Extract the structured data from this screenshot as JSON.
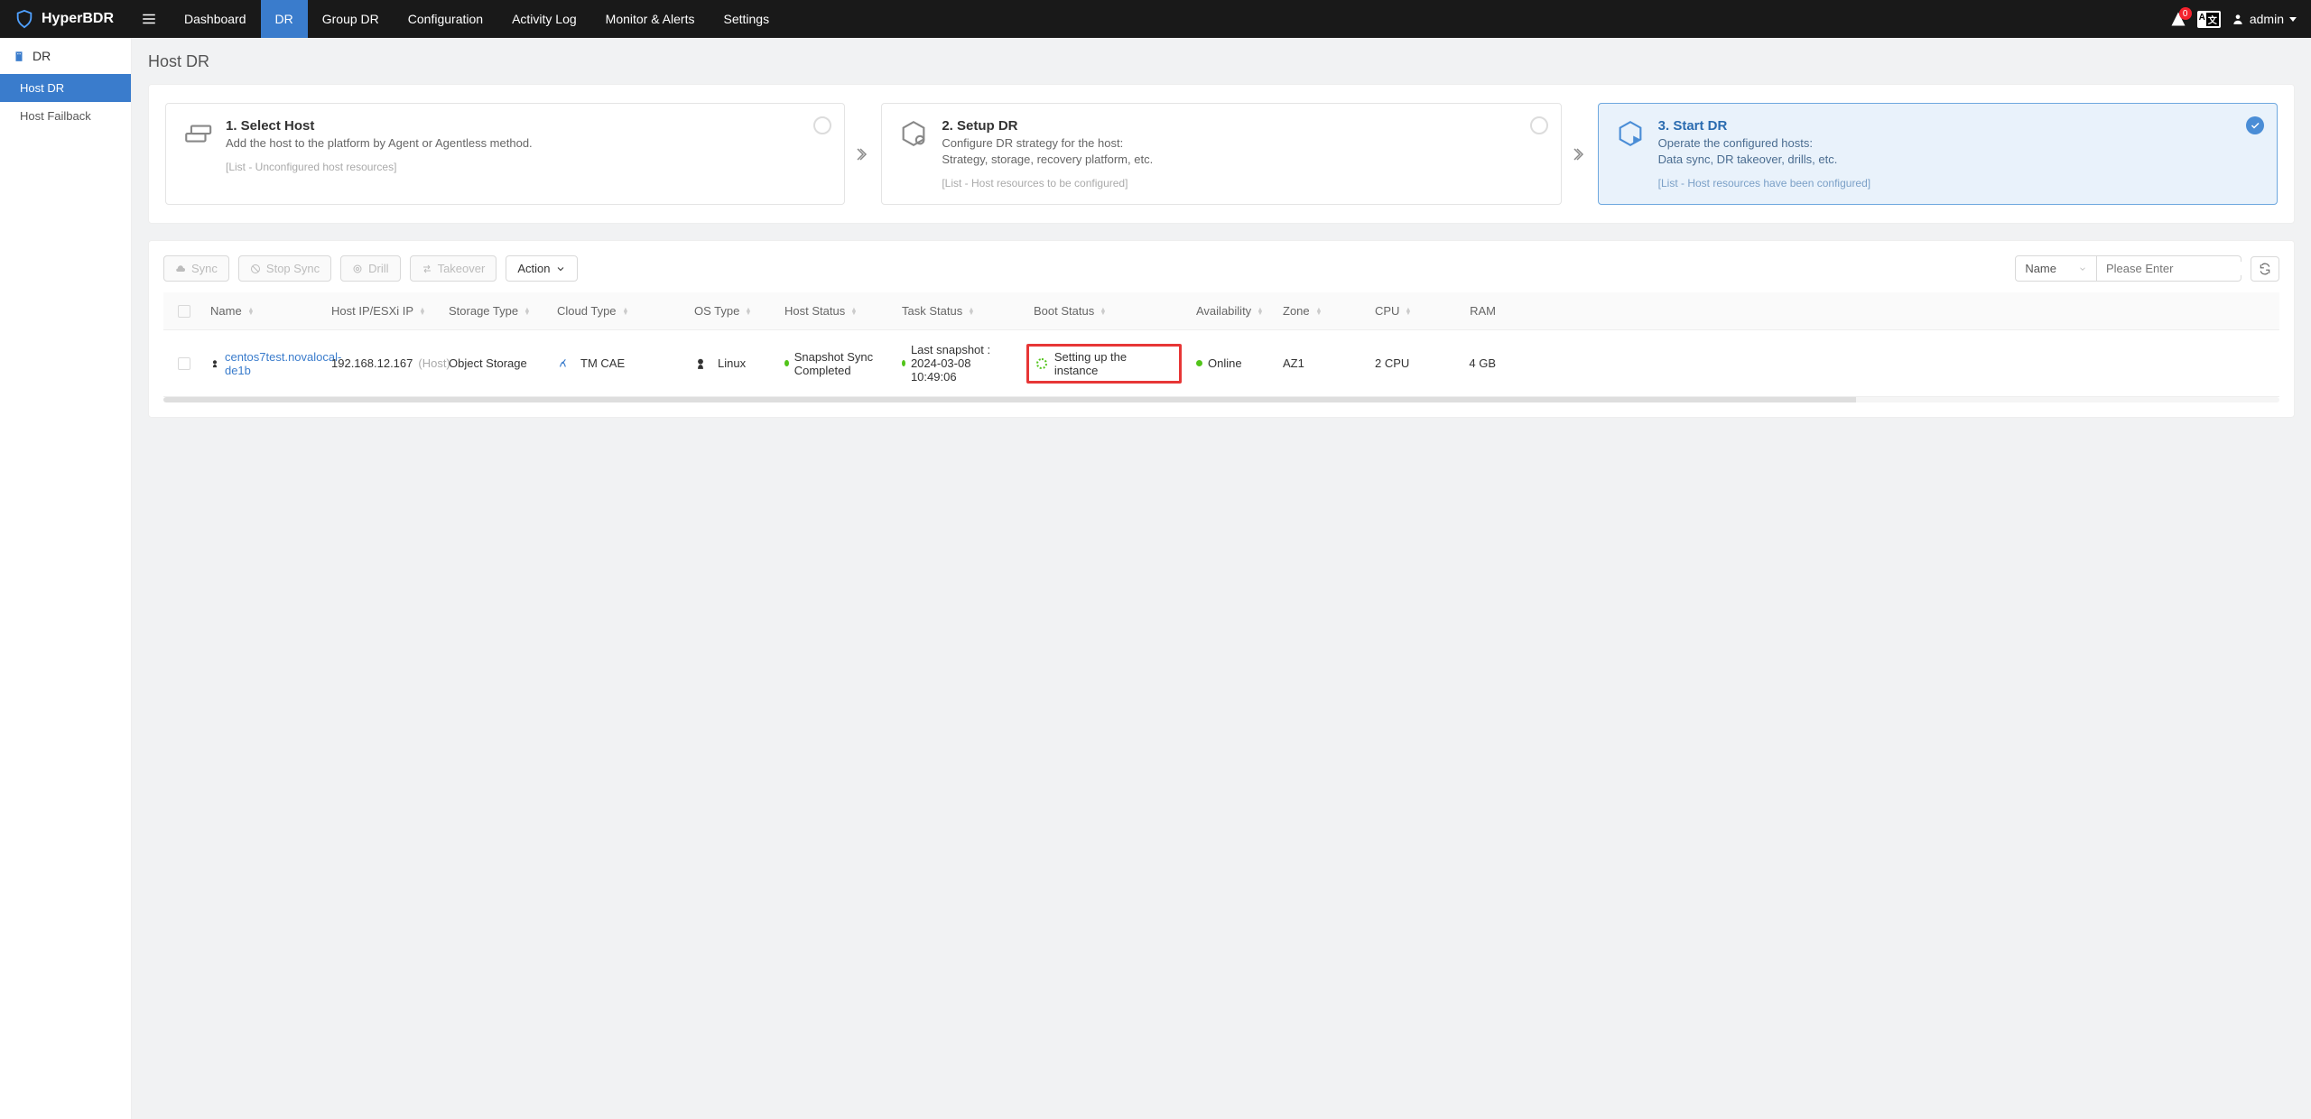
{
  "brand": "HyperBDR",
  "nav": [
    "Dashboard",
    "DR",
    "Group DR",
    "Configuration",
    "Activity Log",
    "Monitor & Alerts",
    "Settings"
  ],
  "nav_active": 1,
  "alerts_count": "0",
  "admin_label": "admin",
  "sidebar": {
    "title": "DR",
    "items": [
      "Host DR",
      "Host Failback"
    ],
    "active": 0
  },
  "page_title": "Host DR",
  "steps": [
    {
      "title": "1. Select Host",
      "desc": "Add the host to the platform by Agent or Agentless method.",
      "sub": "[List - Unconfigured host resources]",
      "state": "circle"
    },
    {
      "title": "2. Setup DR",
      "desc": "Configure DR strategy for the host:\nStrategy, storage, recovery platform, etc.",
      "sub": "[List - Host resources to be configured]",
      "state": "circle"
    },
    {
      "title": "3. Start DR",
      "desc": "Operate the configured hosts:\nData sync, DR takeover, drills, etc.",
      "sub": "[List - Host resources have been configured]",
      "state": "done"
    }
  ],
  "toolbar": {
    "sync": "Sync",
    "stop": "Stop Sync",
    "drill": "Drill",
    "takeover": "Takeover",
    "action": "Action",
    "filter_field": "Name",
    "search_placeholder": "Please Enter"
  },
  "columns": [
    "Name",
    "Host IP/ESXi IP",
    "Storage Type",
    "Cloud Type",
    "OS Type",
    "Host Status",
    "Task Status",
    "Boot Status",
    "Availability",
    "Zone",
    "CPU",
    "RAM"
  ],
  "row": {
    "name": "centos7test.novalocal-de1b",
    "ip": "192.168.12.167",
    "ip_suffix": "(Host)",
    "storage": "Object Storage",
    "cloud": "TM CAE",
    "os": "Linux",
    "host_status": "Snapshot Sync Completed",
    "task_status": "Last snapshot : 2024-03-08 10:49:06",
    "boot_status": "Setting up the instance",
    "availability": "Online",
    "zone": "AZ1",
    "cpu": "2 CPU",
    "ram": "4 GB"
  }
}
